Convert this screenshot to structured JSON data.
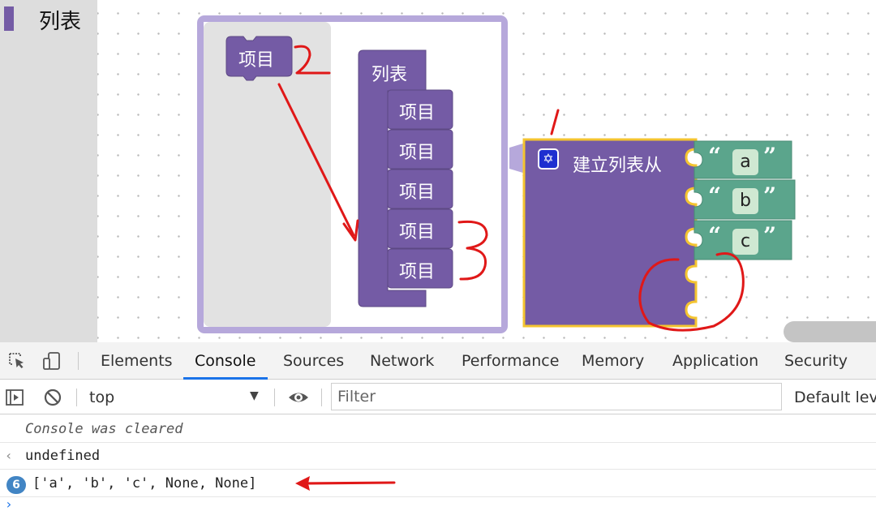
{
  "workspace": {
    "toolbox": {
      "category_label": "列表",
      "category_color": "#745ba5"
    },
    "mutator": {
      "container_label": "列表",
      "item_label": "项目",
      "items": [
        "项目",
        "项目",
        "项目",
        "项目",
        "项目"
      ]
    },
    "create_list_block": {
      "label": "建立列表从",
      "mutator_icon": "gear-icon",
      "color": "#745ba5",
      "strings": [
        "a",
        "b",
        "c"
      ],
      "string_color": "#5ba58c",
      "quote_open": "“",
      "quote_close": "”"
    },
    "annotations": {
      "step2": "2",
      "step3": "3",
      "color": "#e01818"
    }
  },
  "devtools": {
    "tabs": [
      "Elements",
      "Console",
      "Sources",
      "Network",
      "Performance",
      "Memory",
      "Application",
      "Security"
    ],
    "active_tab": "Console",
    "context": "top",
    "filter_placeholder": "Filter",
    "levels_label": "Default leve",
    "console": {
      "cleared_message": "Console was cleared",
      "return_value": "undefined",
      "repeat_count": "6",
      "log_output": "['a', 'b', 'c', None, None]"
    }
  }
}
